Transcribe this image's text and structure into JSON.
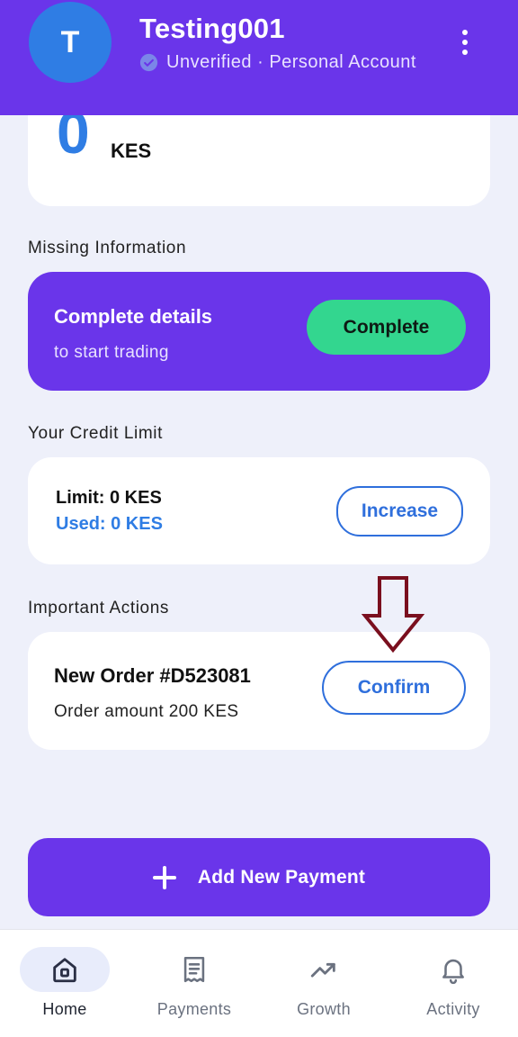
{
  "header": {
    "avatar_initial": "T",
    "user_name": "Testing001",
    "status": "Unverified · Personal Account"
  },
  "balance": {
    "amount": "0",
    "currency": "KES"
  },
  "missing_info": {
    "section_title": "Missing Information",
    "title": "Complete details",
    "subtitle": "to start trading",
    "button_label": "Complete"
  },
  "credit": {
    "section_title": "Your Credit Limit",
    "limit": "Limit: 0 KES",
    "used": "Used: 0 KES",
    "button_label": "Increase"
  },
  "actions": {
    "section_title": "Important Actions",
    "order_title": "New Order #D523081",
    "order_amount": "Order amount 200 KES",
    "button_label": "Confirm"
  },
  "add_payment": {
    "label": "Add New Payment"
  },
  "nav": {
    "items": [
      {
        "label": "Home",
        "icon": "home-icon",
        "active": true
      },
      {
        "label": "Payments",
        "icon": "receipt-icon",
        "active": false
      },
      {
        "label": "Growth",
        "icon": "trending-up-icon",
        "active": false
      },
      {
        "label": "Activity",
        "icon": "bell-icon",
        "active": false
      }
    ]
  },
  "colors": {
    "primary": "#6a35ea",
    "accent_blue": "#2f7de4",
    "success": "#33d68f",
    "annotation_arrow": "#7a0f1e",
    "background": "#eef0fa"
  }
}
